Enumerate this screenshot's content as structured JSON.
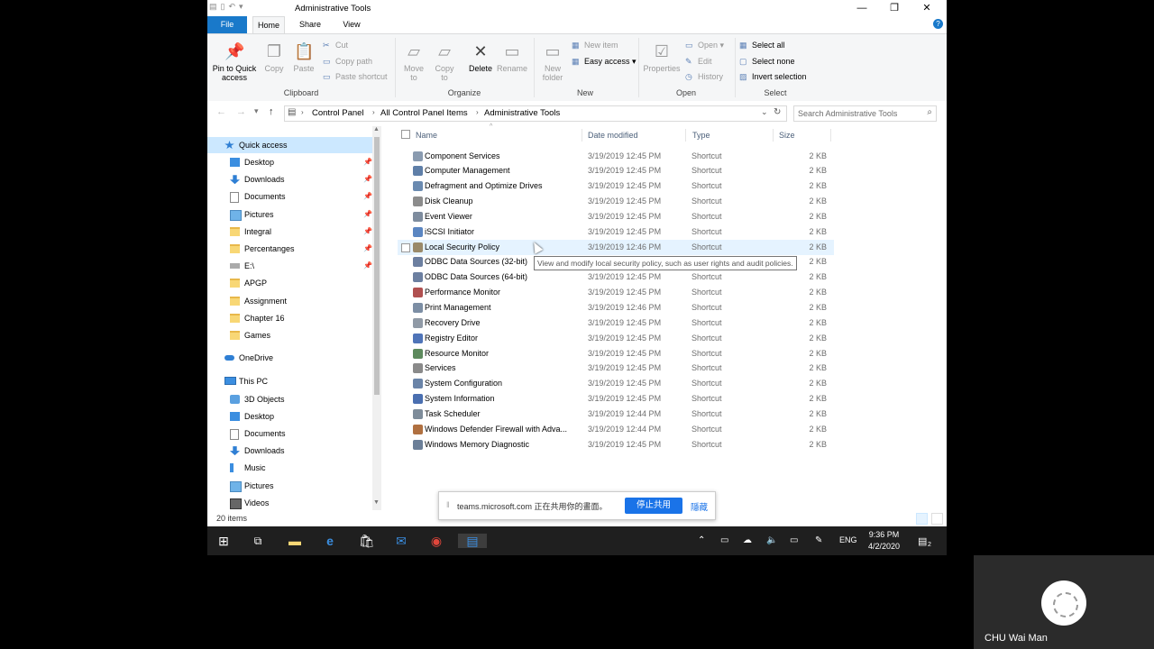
{
  "window": {
    "title": "Administrative Tools",
    "controls": [
      "—",
      "❐",
      "✕"
    ]
  },
  "ribbon": {
    "tabs": [
      "File",
      "Home",
      "Share",
      "View"
    ],
    "clipboard": {
      "pin": "Pin to Quick access",
      "copy": "Copy",
      "paste": "Paste",
      "cut": "Cut",
      "copy_path": "Copy path",
      "paste_shortcut": "Paste shortcut",
      "label": "Clipboard"
    },
    "organize": {
      "move_to": "Move to",
      "copy_to": "Copy to",
      "delete": "Delete",
      "rename": "Rename",
      "label": "Organize"
    },
    "new": {
      "new_folder": "New folder",
      "new_item": "New item",
      "easy_access": "Easy access",
      "label": "New"
    },
    "open": {
      "properties": "Properties",
      "open": "Open",
      "edit": "Edit",
      "history": "History",
      "label": "Open"
    },
    "select": {
      "select_all": "Select all",
      "select_none": "Select none",
      "invert": "Invert selection",
      "label": "Select"
    }
  },
  "address": {
    "crumbs": [
      "Control Panel",
      "All Control Panel Items",
      "Administrative Tools"
    ],
    "search_placeholder": "Search Administrative Tools"
  },
  "nav": {
    "quick_access": "Quick access",
    "quick_items": [
      {
        "label": "Desktop",
        "icon": "desktop-icon",
        "pinned": true
      },
      {
        "label": "Downloads",
        "icon": "downloads-icon",
        "pinned": true
      },
      {
        "label": "Documents",
        "icon": "documents-icon",
        "pinned": true
      },
      {
        "label": "Pictures",
        "icon": "pictures-icon",
        "pinned": true
      },
      {
        "label": "Integral",
        "icon": "folder-icon",
        "pinned": true
      },
      {
        "label": "Percentanges",
        "icon": "folder-icon",
        "pinned": true
      },
      {
        "label": "E:\\",
        "icon": "drive-icon",
        "pinned": true
      },
      {
        "label": "APGP",
        "icon": "folder-icon",
        "pinned": false
      },
      {
        "label": "Assignment",
        "icon": "folder-icon",
        "pinned": false
      },
      {
        "label": "Chapter 16",
        "icon": "folder-icon",
        "pinned": false
      },
      {
        "label": "Games",
        "icon": "folder-icon",
        "pinned": false
      }
    ],
    "onedrive": "OneDrive",
    "this_pc": "This PC",
    "pc_items": [
      {
        "label": "3D Objects",
        "icon": "3d-objects-icon"
      },
      {
        "label": "Desktop",
        "icon": "desktop-icon"
      },
      {
        "label": "Documents",
        "icon": "documents-icon"
      },
      {
        "label": "Downloads",
        "icon": "downloads-icon"
      },
      {
        "label": "Music",
        "icon": "music-icon"
      },
      {
        "label": "Pictures",
        "icon": "pictures-icon"
      },
      {
        "label": "Videos",
        "icon": "videos-icon"
      }
    ]
  },
  "filelist": {
    "columns": [
      "Name",
      "Date modified",
      "Type",
      "Size"
    ],
    "rows": [
      {
        "name": "Component Services",
        "date": "3/19/2019 12:45 PM",
        "type": "Shortcut",
        "size": "2 KB",
        "color": "#8a9bb0"
      },
      {
        "name": "Computer Management",
        "date": "3/19/2019 12:45 PM",
        "type": "Shortcut",
        "size": "2 KB",
        "color": "#5f7fa8"
      },
      {
        "name": "Defragment and Optimize Drives",
        "date": "3/19/2019 12:45 PM",
        "type": "Shortcut",
        "size": "2 KB",
        "color": "#6a8ab0"
      },
      {
        "name": "Disk Cleanup",
        "date": "3/19/2019 12:45 PM",
        "type": "Shortcut",
        "size": "2 KB",
        "color": "#8c8c8c"
      },
      {
        "name": "Event Viewer",
        "date": "3/19/2019 12:45 PM",
        "type": "Shortcut",
        "size": "2 KB",
        "color": "#7e8c9e"
      },
      {
        "name": "iSCSI Initiator",
        "date": "3/19/2019 12:45 PM",
        "type": "Shortcut",
        "size": "2 KB",
        "color": "#5b86c2"
      },
      {
        "name": "Local Security Policy",
        "date": "3/19/2019 12:46 PM",
        "type": "Shortcut",
        "size": "2 KB",
        "color": "#9a8a6a"
      },
      {
        "name": "ODBC Data Sources (32-bit)",
        "date": "3/19/2019 12:45 PM",
        "type": "Shortcut",
        "size": "2 KB",
        "color": "#6c7fa0"
      },
      {
        "name": "ODBC Data Sources (64-bit)",
        "date": "3/19/2019 12:45 PM",
        "type": "Shortcut",
        "size": "2 KB",
        "color": "#6c7fa0"
      },
      {
        "name": "Performance Monitor",
        "date": "3/19/2019 12:45 PM",
        "type": "Shortcut",
        "size": "2 KB",
        "color": "#b05050"
      },
      {
        "name": "Print Management",
        "date": "3/19/2019 12:46 PM",
        "type": "Shortcut",
        "size": "2 KB",
        "color": "#7c8ea4"
      },
      {
        "name": "Recovery Drive",
        "date": "3/19/2019 12:45 PM",
        "type": "Shortcut",
        "size": "2 KB",
        "color": "#909aa6"
      },
      {
        "name": "Registry Editor",
        "date": "3/19/2019 12:45 PM",
        "type": "Shortcut",
        "size": "2 KB",
        "color": "#4f74b8"
      },
      {
        "name": "Resource Monitor",
        "date": "3/19/2019 12:45 PM",
        "type": "Shortcut",
        "size": "2 KB",
        "color": "#5d8a5d"
      },
      {
        "name": "Services",
        "date": "3/19/2019 12:45 PM",
        "type": "Shortcut",
        "size": "2 KB",
        "color": "#8a8a8a"
      },
      {
        "name": "System Configuration",
        "date": "3/19/2019 12:45 PM",
        "type": "Shortcut",
        "size": "2 KB",
        "color": "#6a84a8"
      },
      {
        "name": "System Information",
        "date": "3/19/2019 12:45 PM",
        "type": "Shortcut",
        "size": "2 KB",
        "color": "#4a6fb0"
      },
      {
        "name": "Task Scheduler",
        "date": "3/19/2019 12:44 PM",
        "type": "Shortcut",
        "size": "2 KB",
        "color": "#7e8c9a"
      },
      {
        "name": "Windows Defender Firewall with Adva...",
        "date": "3/19/2019 12:44 PM",
        "type": "Shortcut",
        "size": "2 KB",
        "color": "#b07040"
      },
      {
        "name": "Windows Memory Diagnostic",
        "date": "3/19/2019 12:45 PM",
        "type": "Shortcut",
        "size": "2 KB",
        "color": "#6b7f98"
      }
    ],
    "hovered_row": "Local Security Policy",
    "tooltip": "View and modify local security policy, such as user rights and audit policies."
  },
  "status": {
    "item_count": "20 items"
  },
  "share_banner": {
    "text": "teams.microsoft.com 正在共用你的畫面。",
    "stop": "停止共用",
    "hide": "隱藏"
  },
  "taskbar": {
    "language": "ENG",
    "time": "9:36 PM",
    "date": "4/2/2020",
    "notification_count": "2"
  },
  "participant": {
    "name": "CHU Wai Man"
  }
}
